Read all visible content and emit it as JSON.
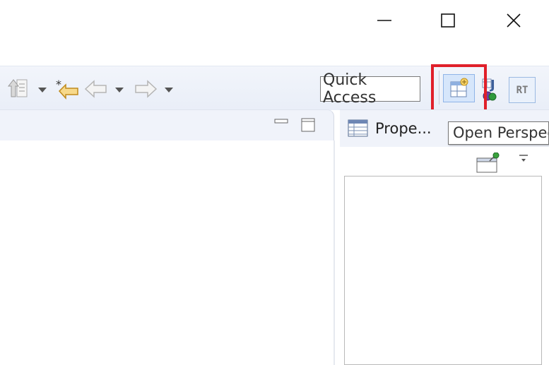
{
  "window": {
    "minimize_icon": "minimize-icon",
    "maximize_icon": "maximize-icon",
    "close_icon": "close-icon"
  },
  "toolbar": {
    "items": [
      {
        "icon": "previous-annotation-icon"
      },
      {
        "icon": "last-edit-location-icon"
      },
      {
        "icon": "back-arrow-icon"
      },
      {
        "icon": "forward-arrow-icon"
      }
    ],
    "quick_access": "Quick Access",
    "open_perspective_icon": "open-perspective-icon",
    "java_perspective_icon": "java-perspective-icon",
    "rt_perspective_label": "RT"
  },
  "properties_view": {
    "tab_label": "Prope..."
  },
  "tooltip": {
    "text": "Open Perspective"
  },
  "colors": {
    "highlight": "#e0202a",
    "toolbar_bg": "#eef2fa",
    "selected_button_bg": "#d6e6fb"
  }
}
